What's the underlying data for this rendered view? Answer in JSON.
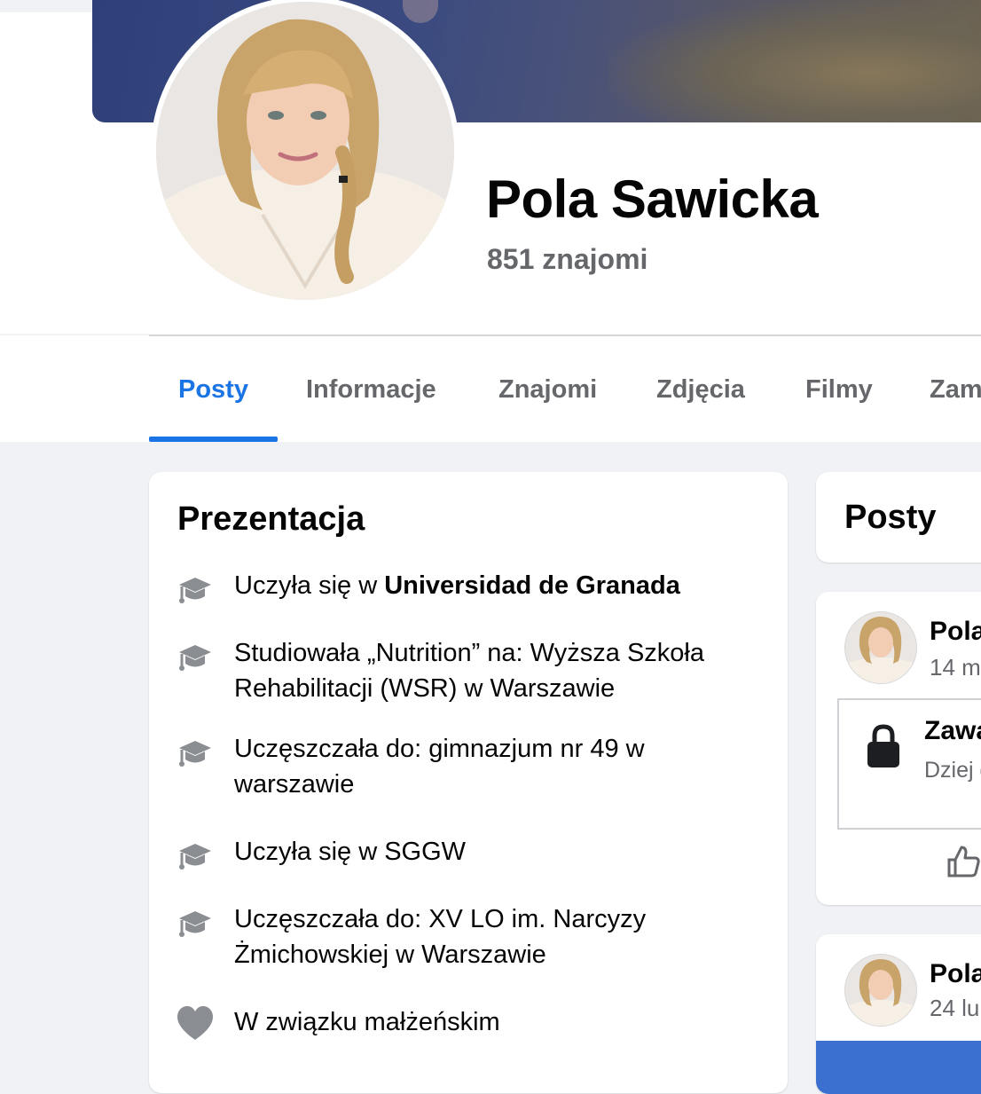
{
  "profile": {
    "name": "Pola Sawicka",
    "friends": "851 znajomi"
  },
  "tabs": [
    {
      "label": "Posty",
      "active": true
    },
    {
      "label": "Informacje",
      "active": false
    },
    {
      "label": "Znajomi",
      "active": false
    },
    {
      "label": "Zdjęcia",
      "active": false
    },
    {
      "label": "Filmy",
      "active": false
    },
    {
      "label": "Zam",
      "active": false
    }
  ],
  "intro": {
    "title": "Prezentacja",
    "items": [
      {
        "icon": "graduation-cap-icon",
        "prefix": "Uczyła się w ",
        "bold": "Universidad de Granada",
        "suffix": ""
      },
      {
        "icon": "graduation-cap-icon",
        "prefix": "Studiowała „Nutrition” na: Wyższa Szkoła Rehabilitacji (WSR) w Warszawie",
        "bold": "",
        "suffix": ""
      },
      {
        "icon": "graduation-cap-icon",
        "prefix": "Uczęszczała do: gimnazjum nr 49 w warszawie",
        "bold": "",
        "suffix": ""
      },
      {
        "icon": "graduation-cap-icon",
        "prefix": "Uczyła się w SGGW",
        "bold": "",
        "suffix": ""
      },
      {
        "icon": "graduation-cap-icon",
        "prefix": "Uczęszczała do: XV LO im. Narcyzy Żmichowskiej w Warszawie",
        "bold": "",
        "suffix": ""
      },
      {
        "icon": "heart-icon",
        "prefix": "W związku małżeńskim",
        "bold": "",
        "suffix": ""
      }
    ]
  },
  "posts": {
    "title": "Posty",
    "items": [
      {
        "author": "Pola",
        "date": "14 m",
        "locked_title": "Zawa",
        "locked_desc": "Dziej grupi"
      },
      {
        "author": "Pola",
        "date": "24 lu"
      }
    ]
  },
  "colors": {
    "accent": "#1b74e4",
    "icon_gray": "#8a8d91",
    "secondary_text": "#65676b"
  }
}
